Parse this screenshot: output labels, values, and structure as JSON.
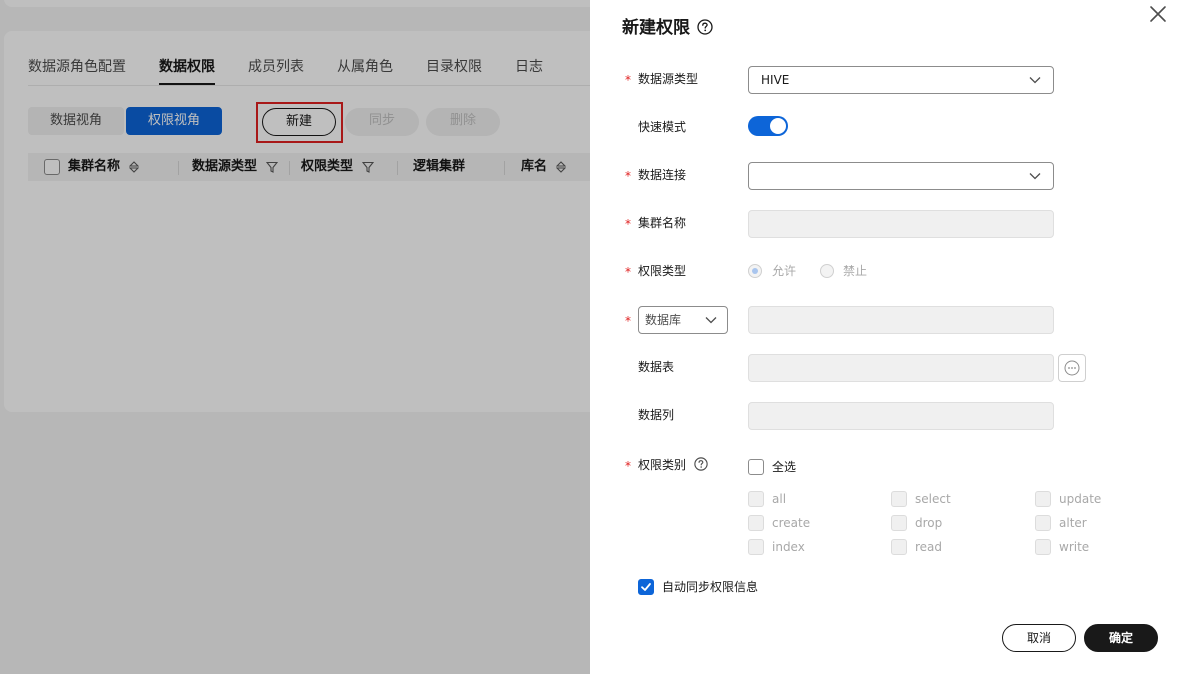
{
  "background": {
    "tabs": [
      {
        "label": "数据源角色配置",
        "active": false
      },
      {
        "label": "数据权限",
        "active": true
      },
      {
        "label": "成员列表",
        "active": false
      },
      {
        "label": "从属角色",
        "active": false
      },
      {
        "label": "目录权限",
        "active": false
      },
      {
        "label": "日志",
        "active": false
      }
    ],
    "view_switch": {
      "data_view": "数据视角",
      "perm_view": "权限视角"
    },
    "actions": {
      "new": "新建",
      "sync": "同步",
      "delete": "删除"
    },
    "table_headers": [
      "集群名称",
      "数据源类型",
      "权限类型",
      "逻辑集群",
      "库名"
    ]
  },
  "drawer": {
    "title": "新建权限",
    "fields": {
      "datasource_type": {
        "label": "数据源类型",
        "value": "HIVE",
        "required": true
      },
      "fast_mode": {
        "label": "快速模式",
        "enabled": true
      },
      "data_connection": {
        "label": "数据连接",
        "value": "",
        "required": true
      },
      "cluster_name": {
        "label": "集群名称",
        "value": "",
        "required": true
      },
      "permission_type": {
        "label": "权限类型",
        "required": true,
        "options": [
          "允许",
          "禁止"
        ],
        "selected": "允许"
      },
      "database": {
        "selector": "数据库",
        "value": "",
        "required": true
      },
      "table": {
        "label": "数据表",
        "value": ""
      },
      "column": {
        "label": "数据列",
        "value": ""
      },
      "permission_category": {
        "label": "权限类别",
        "required": true,
        "select_all": "全选",
        "options": [
          "all",
          "select",
          "update",
          "create",
          "drop",
          "alter",
          "index",
          "read",
          "write"
        ]
      },
      "auto_sync": {
        "label": "自动同步权限信息",
        "checked": true
      }
    },
    "buttons": {
      "cancel": "取消",
      "confirm": "确定"
    }
  },
  "colors": {
    "primary": "#0d65d8",
    "required": "#e02020",
    "highlight": "#e02020",
    "dark_button": "#191919"
  }
}
